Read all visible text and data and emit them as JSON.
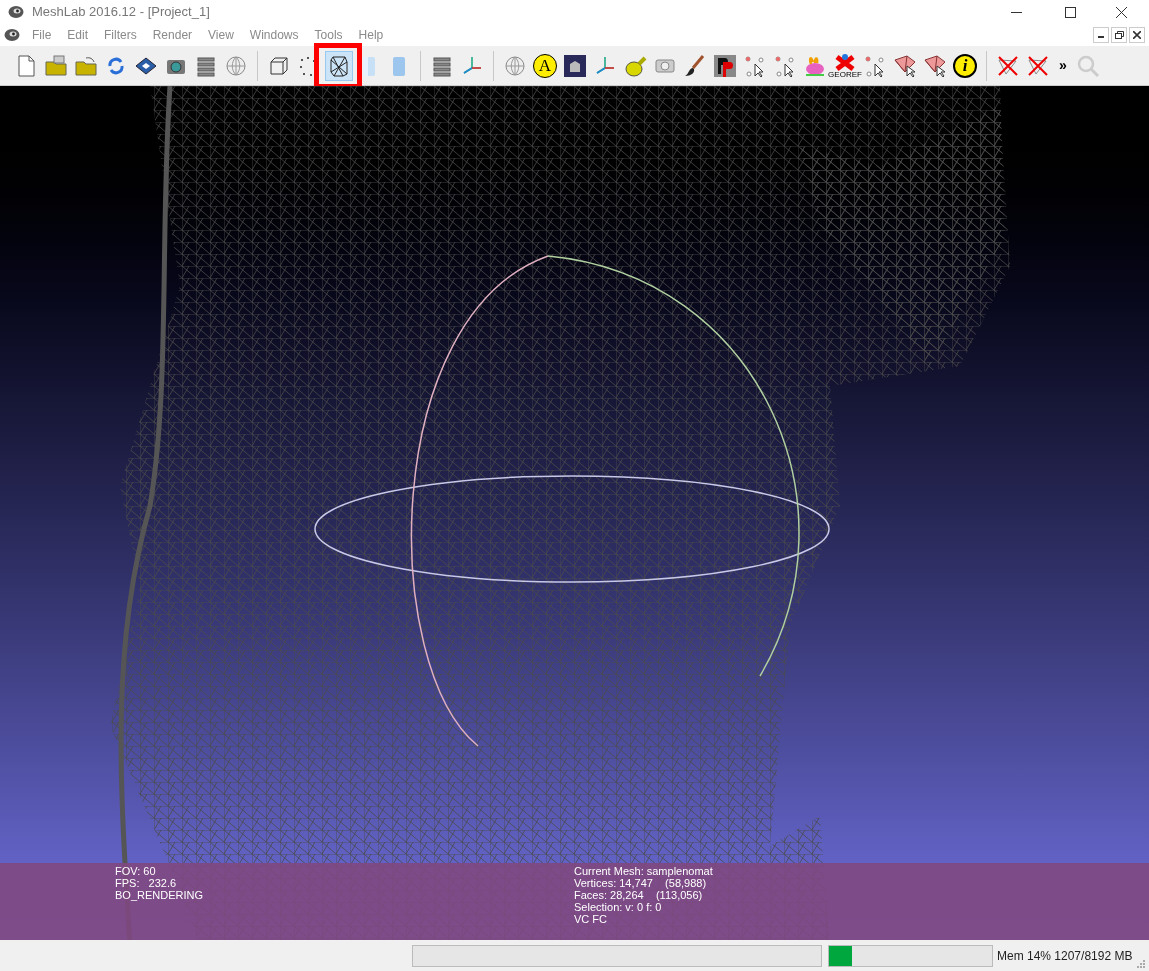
{
  "window": {
    "title": "MeshLab 2016.12 - [Project_1]"
  },
  "menu": [
    {
      "label": "File",
      "disabled": true
    },
    {
      "label": "Edit",
      "disabled": true
    },
    {
      "label": "Filters",
      "disabled": true
    },
    {
      "label": "Render",
      "disabled": true
    },
    {
      "label": "View",
      "disabled": true
    },
    {
      "label": "Windows",
      "disabled": true
    },
    {
      "label": "Tools",
      "disabled": true
    },
    {
      "label": "Help",
      "disabled": true
    }
  ],
  "toolbar": [
    {
      "kind": "new",
      "selected": false
    },
    {
      "kind": "open-project",
      "selected": false
    },
    {
      "kind": "open",
      "selected": false
    },
    {
      "kind": "reload",
      "selected": false
    },
    {
      "kind": "save",
      "selected": false
    },
    {
      "kind": "snapshot",
      "selected": false
    },
    {
      "kind": "layers",
      "selected": false
    },
    {
      "kind": "globe",
      "selected": false
    },
    {
      "kind": "separator"
    },
    {
      "kind": "bbox",
      "selected": false
    },
    {
      "kind": "points",
      "selected": false
    },
    {
      "kind": "wire",
      "selected": true,
      "highlighted": true
    },
    {
      "kind": "flat",
      "selected": false
    },
    {
      "kind": "smooth",
      "selected": false
    },
    {
      "kind": "separator"
    },
    {
      "kind": "layers",
      "selected": false
    },
    {
      "kind": "axes",
      "selected": false
    },
    {
      "kind": "separator"
    },
    {
      "kind": "globe",
      "selected": false
    },
    {
      "kind": "letter",
      "label": "A",
      "selected": false
    },
    {
      "kind": "dark",
      "selected": false
    },
    {
      "kind": "axes",
      "selected": false
    },
    {
      "kind": "tape",
      "selected": false
    },
    {
      "kind": "camera",
      "selected": false
    },
    {
      "kind": "brush",
      "selected": false
    },
    {
      "kind": "pp",
      "selected": false
    },
    {
      "kind": "select",
      "selected": false
    },
    {
      "kind": "select",
      "selected": false
    },
    {
      "kind": "bunny",
      "selected": false
    },
    {
      "kind": "georef",
      "label": "GEOREF",
      "selected": false
    },
    {
      "kind": "select",
      "selected": false
    },
    {
      "kind": "faces",
      "selected": false
    },
    {
      "kind": "faces",
      "selected": false
    },
    {
      "kind": "info",
      "label": "i",
      "selected": false
    },
    {
      "kind": "separator"
    },
    {
      "kind": "delete",
      "selected": false
    },
    {
      "kind": "delete",
      "selected": false
    },
    {
      "kind": "more",
      "label": "»"
    },
    {
      "kind": "search",
      "selected": false
    }
  ],
  "overlay": {
    "left": [
      "FOV: 60",
      "FPS:   232.6",
      "BO_RENDERING"
    ],
    "right": [
      "Current Mesh: samplenomat",
      "Vertices: 14,747    (58,988)",
      "Faces: 28,264    (113,056)",
      "Selection: v: 0 f: 0",
      "VC FC"
    ]
  },
  "status_bar": {
    "progress": {
      "level": 0
    },
    "memory": {
      "level": 0.14,
      "text": "Mem 14% 1207/8192 MB"
    }
  }
}
